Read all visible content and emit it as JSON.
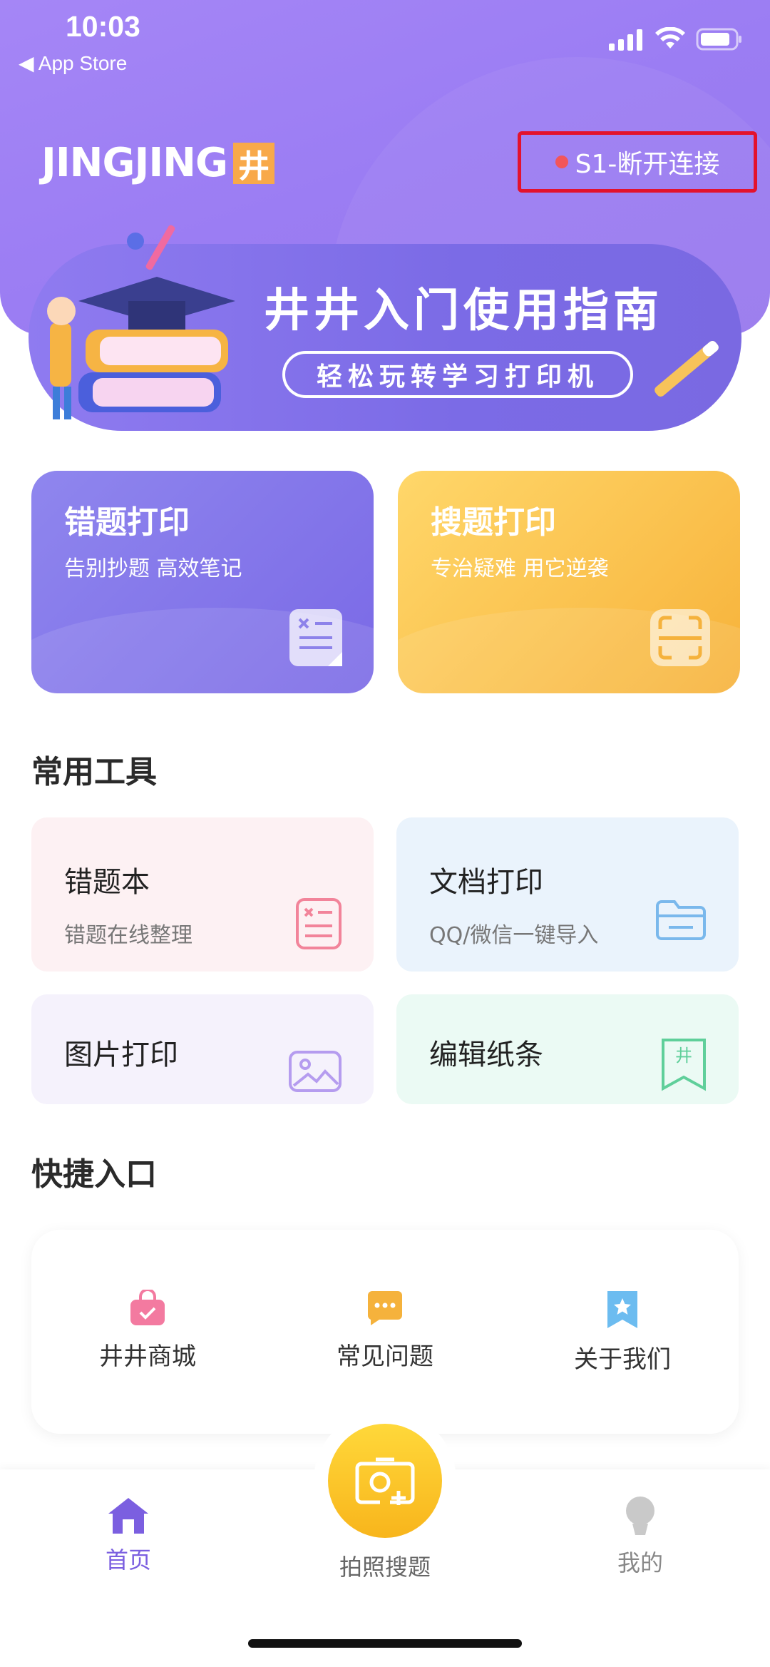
{
  "status_bar": {
    "time": "10:03",
    "back_label": "◀ App Store"
  },
  "header": {
    "brand_text": "JINGJING",
    "brand_badge": "井",
    "connection_label": "S1-断开连接",
    "connection_dot_color": "#f2555a",
    "highlight_color": "#e3122d"
  },
  "banner": {
    "title": "井井入门使用指南",
    "subtitle": "轻松玩转学习打印机"
  },
  "features": [
    {
      "title": "错题打印",
      "subtitle": "告别抄题 高效笔记",
      "icon": "wrong-question-doc-icon"
    },
    {
      "title": "搜题打印",
      "subtitle": "专治疑难 用它逆袭",
      "icon": "scan-frame-icon"
    }
  ],
  "tools_section": {
    "title": "常用工具",
    "items": [
      {
        "name": "错题本",
        "subtitle": "错题在线整理",
        "icon": "notebook-icon"
      },
      {
        "name": "文档打印",
        "subtitle": "QQ/微信一键导入",
        "icon": "folder-icon"
      },
      {
        "name": "图片打印",
        "icon": "image-icon"
      },
      {
        "name": "编辑纸条",
        "icon": "bookmark-icon"
      }
    ]
  },
  "quick_section": {
    "title": "快捷入口",
    "items": [
      {
        "label": "井井商城",
        "icon": "shopping-bag-icon"
      },
      {
        "label": "常见问题",
        "icon": "chat-bubble-icon"
      },
      {
        "label": "关于我们",
        "icon": "star-bookmark-icon"
      }
    ]
  },
  "tabbar": {
    "home": "首页",
    "photo_search": "拍照搜题",
    "mine": "我的",
    "active_color": "#7b5fe0",
    "inactive_color": "#888888"
  }
}
